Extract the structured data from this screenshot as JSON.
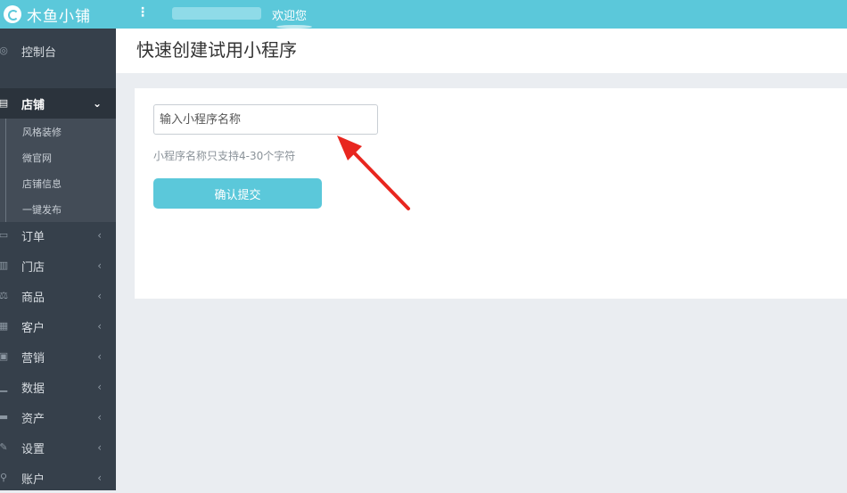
{
  "brand": {
    "name": "木鱼小铺",
    "color": "#5bc8da"
  },
  "topbar": {
    "welcome": "欢迎您",
    "menu_icon": "vertical-dots-icon"
  },
  "sidebar": {
    "items": [
      {
        "label": "控制台",
        "icon": "dashboard-icon"
      },
      {
        "label": "店铺",
        "icon": "store-icon",
        "active": true,
        "expanded": true
      },
      {
        "label": "订单",
        "icon": "order-icon"
      },
      {
        "label": "门店",
        "icon": "shop-icon"
      },
      {
        "label": "商品",
        "icon": "goods-icon"
      },
      {
        "label": "客户",
        "icon": "customer-icon"
      },
      {
        "label": "营销",
        "icon": "marketing-icon"
      },
      {
        "label": "数据",
        "icon": "chart-icon"
      },
      {
        "label": "资产",
        "icon": "wallet-icon"
      },
      {
        "label": "设置",
        "icon": "wrench-icon"
      },
      {
        "label": "账户",
        "icon": "account-icon"
      }
    ],
    "store_sub": [
      "风格装修",
      "微官网",
      "店铺信息",
      "一键发布"
    ]
  },
  "main": {
    "title": "快速创建试用小程序",
    "input_placeholder": "输入小程序名称",
    "hint": "小程序名称只支持4-30个字符",
    "submit_label": "确认提交"
  }
}
